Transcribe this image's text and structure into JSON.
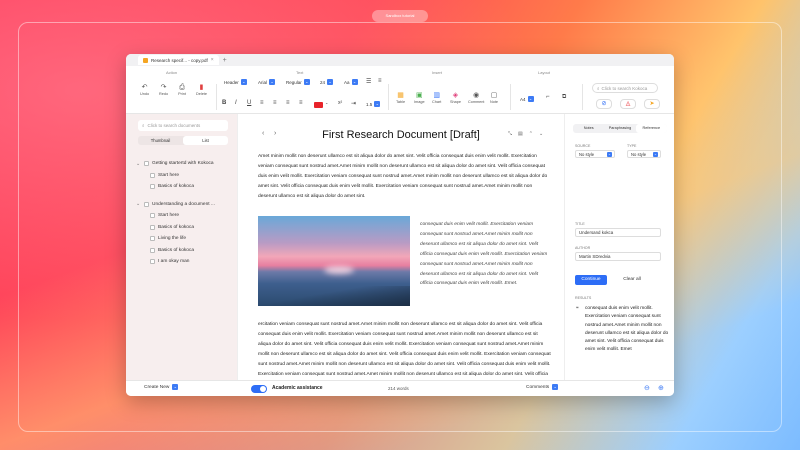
{
  "desktop": {
    "pill_label": "Sandbox tutorial"
  },
  "tabs": [
    {
      "label": "Research specif... - copy.pdf"
    }
  ],
  "toolbar": {
    "action_title": "Action",
    "text_title": "Text",
    "insert_title": "Insert",
    "layout_title": "Layout",
    "actions": [
      "Undo",
      "Redo",
      "Print",
      "Delete"
    ],
    "style_select": "Header",
    "font_select": "Arial",
    "weight_select": "Regular",
    "size_value": "24",
    "case_label": "Aa",
    "line_spacing": "1.5",
    "inserts": [
      "Table",
      "Image",
      "Chart",
      "Shape",
      "Comment",
      "Note"
    ],
    "page_size": "A4",
    "search_placeholder": "Click to search Kokoca"
  },
  "sidebar": {
    "search_placeholder": "Click to search documents",
    "view_tabs": [
      "Thumbnail",
      "List"
    ],
    "tree": [
      {
        "label": "Getting startertd with Kokoca",
        "children": [
          "Start here",
          "Basics of kokoca"
        ]
      },
      {
        "label": "Understanding a document ...",
        "children": [
          "Start here",
          "Basics of kokoca",
          "Living the life",
          "Basics of kokoca",
          "I am okay man"
        ]
      }
    ],
    "create_new": "Create New"
  },
  "document": {
    "title": "First Research Document [Draft]",
    "para1": "Amet minim mollit non deserunt ullamco est sit aliqua dolor do amet sint. Velit officia consequat duis enim velit mollit. Exercitation veniam consequat sunt nostrud amet.Amet minim mollit non deserunt ullamco est sit aliqua dolor do amet sint. Velit officia consequat duis enim velit mollit. Exercitation veniam consequat sunt nostrud amet.Amet minim mollit non deserunt ullamco est sit aliqua dolor do amet sint. Velit officia consequat duis enim velit mollit. Exercitation veniam consequat sunt nostrud amet.Amet minim mollit non deserunt ullamco est sit aliqua dolor do amet sint.",
    "italic_text": "consequat duis enim velit mollit. Exercitation veniam consequat sunt nostrud amet.Amet minim mollit non deserunt ullamco est sit aliqua dolor do amet sint. Velit officia consequat duis enim velit mollit. Exercitation veniam consequat sunt nostrud amet.Amet minim mollit non deserunt ullamco est sit aliqua dolor do amet sint. Velit officia consequat duis enim velit mollit. Emet.",
    "para2": "ercitation veniam consequat sunt nostrud amet.Amet minim mollit non deserunt ullamco est sit aliqua dolor do amet sint. Velit officia consequat duis enim velit mollit. Exercitation veniam consequat sunt nostrud amet.Amet minim mollit non deserunt ullamco est sit aliqua dolor do amet sint. Velit officia consequat duis enim velit mollit. Exercitation veniam consequat sunt nostrud amet.Amet minim mollit non deserunt ullamco est sit aliqua dolor do amet sint. Velit officia consequat duis enim velit mollit. Exercitation veniam consequat sunt nostrud amet.Amet minim mollit non deserunt ullamco est sit aliqua dolor do amet sint. Velit officia consequat duis enim velit mollit. Exercitation veniam consequat sunt nostrud amet.Amet minim mollit non deserunt ullamco est sit aliqua dolor do amet sint. Velit officia consequat duis enim velit mollit."
  },
  "right_panel": {
    "tabs": [
      "Notes",
      "Paraphrasing",
      "Reference"
    ],
    "source_label": "SOURCE",
    "source_value": "No style",
    "type_label": "TYPE",
    "type_value": "No style",
    "title_label": "TITLE",
    "title_value": "Undersand kokca",
    "author_label": "AUTHOR",
    "author_value": "Martin SDredvia",
    "continue": "Continue",
    "clear": "Clear all",
    "results_label": "RESULTS",
    "result_text": "consequat duis enim velit mollit. Exercitation veniam consequat sunt nostrud amet.Amet minim mollit non deserunt ullamco est sit aliqua dolor do amet sint. Velit officia consequat duis enim velit mollit. Emet"
  },
  "bottom": {
    "assist_label": "Academic assistance",
    "word_count": "214 words",
    "comments": "Comments"
  }
}
